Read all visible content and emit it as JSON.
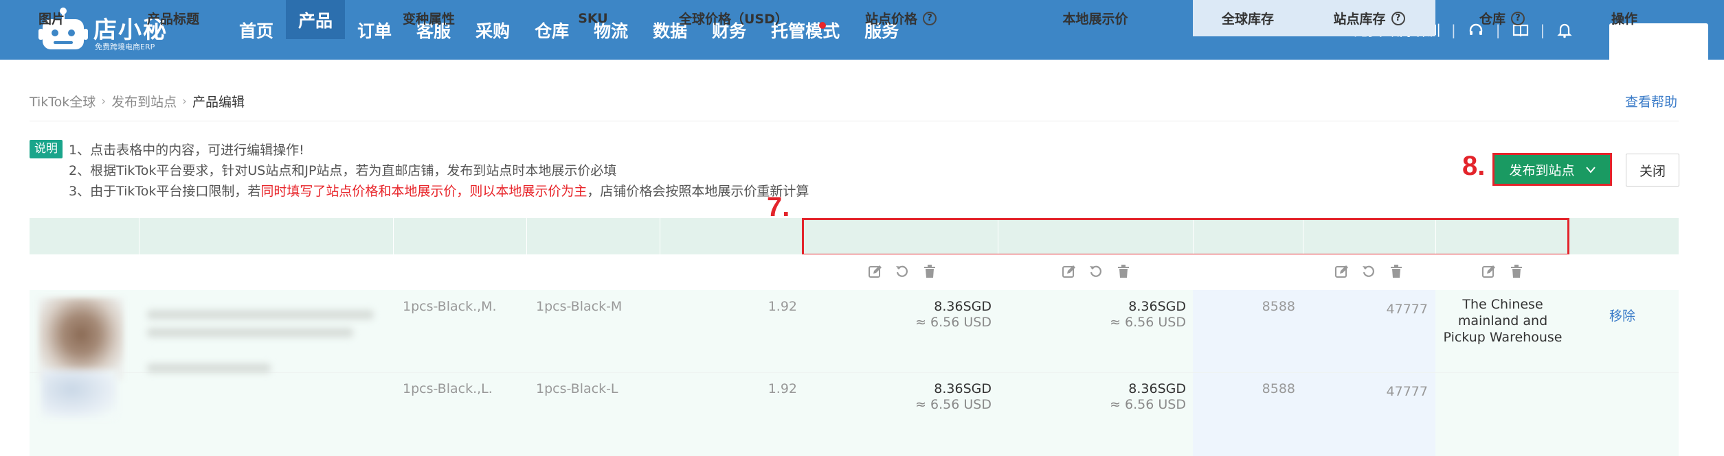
{
  "app": {
    "logo_title": "店小秘",
    "logo_subtitle": "免费跨境电商ERP"
  },
  "nav": {
    "items": [
      "首页",
      "产品",
      "订单",
      "客服",
      "采购",
      "仓库",
      "物流",
      "数据",
      "财务",
      "托管模式",
      "服务"
    ],
    "active": "产品"
  },
  "top_right": {
    "training": "免费专属培训",
    "separator": "|",
    "icons": [
      "headset-icon",
      "book-icon",
      "bell-icon"
    ]
  },
  "breadcrumb": {
    "items": [
      "TikTok全球",
      "发布到站点",
      "产品编辑"
    ]
  },
  "help": "查看帮助",
  "notes": {
    "badge": "说明",
    "line1": "1、点击表格中的内容，可进行编辑操作!",
    "line2": "2、根据TikTok平台要求，针对US站点和JP站点，若为直邮店铺，发布到站点时本地展示价必填",
    "line3_prefix": "3、由于TikTok平台接口限制，若",
    "line3_red": "同时填写了站点价格和本地展示价，则以本地展示价为主",
    "line3_suffix": "，店铺价格会按照本地展示价重新计算"
  },
  "buttons": {
    "publish": "发布到站点",
    "close": "关闭"
  },
  "annotations": {
    "step7": "7.",
    "step8": "8."
  },
  "table": {
    "headers": {
      "image": "图片",
      "title": "产品标题",
      "variant": "变种属性",
      "sku": "SKU",
      "global_price": "全球价格（USD）",
      "site_price": "站点价格",
      "local_price": "本地展示价",
      "global_stock": "全球库存",
      "site_stock": "站点库存",
      "warehouse": "仓库",
      "action": "操作"
    },
    "rows": [
      {
        "variant": "1pcs-Black.,M.",
        "sku": "1pcs-Black-M",
        "global_price": "1.92",
        "site_price": "8.36SGD",
        "site_price_usd": "≈ 6.56 USD",
        "local_price": "8.36SGD",
        "local_price_usd": "≈ 6.56 USD",
        "global_stock": "8588",
        "site_stock": "47777"
      },
      {
        "variant": "1pcs-Black.,L.",
        "sku": "1pcs-Black-L",
        "global_price": "1.92",
        "site_price": "8.36SGD",
        "site_price_usd": "≈ 6.56 USD",
        "local_price": "8.36SGD",
        "local_price_usd": "≈ 6.56 USD",
        "global_stock": "8588",
        "site_stock": "47777"
      }
    ],
    "warehouse": "The Chinese mainland and Pickup Warehouse",
    "action": "移除"
  },
  "colors": {
    "topbar": "#3d86c6",
    "publish_button": "#1a9a62",
    "annotation": "#e3242b",
    "header_green": "#e3f2ec",
    "header_blue": "#dce9f6",
    "link": "#3a7bc8"
  }
}
